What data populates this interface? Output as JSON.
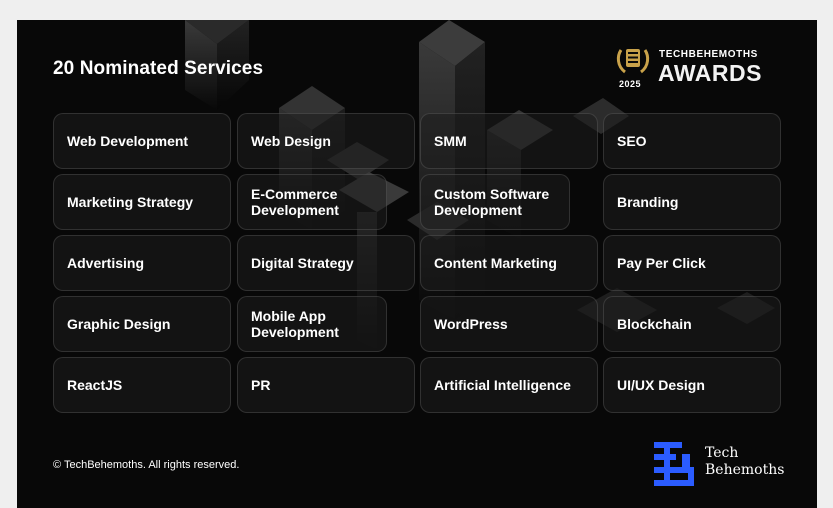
{
  "header": {
    "title": "20 Nominated Services"
  },
  "award": {
    "brand": "TECHBEHEMOTHS",
    "awards": "AWARDS",
    "year": "2025",
    "accent_color": "#c9a24a"
  },
  "services": [
    {
      "label": "Web Development"
    },
    {
      "label": "Web Design"
    },
    {
      "label": "SMM"
    },
    {
      "label": "SEO"
    },
    {
      "label": "Marketing Strategy"
    },
    {
      "label": "E-Commerce Development"
    },
    {
      "label": "Custom Software Development"
    },
    {
      "label": "Branding"
    },
    {
      "label": "Advertising"
    },
    {
      "label": "Digital Strategy"
    },
    {
      "label": "Content Marketing"
    },
    {
      "label": "Pay Per Click"
    },
    {
      "label": "Graphic Design"
    },
    {
      "label": "Mobile App Development"
    },
    {
      "label": "WordPress"
    },
    {
      "label": "Blockchain"
    },
    {
      "label": "ReactJS"
    },
    {
      "label": "PR"
    },
    {
      "label": "Artificial Intelligence"
    },
    {
      "label": "UI/UX Design"
    }
  ],
  "footer": {
    "copyright": "© TechBehemoths. All rights reserved.",
    "logo_line1": "Tech",
    "logo_line2": "Behemoths",
    "logo_color": "#2b5cff"
  }
}
